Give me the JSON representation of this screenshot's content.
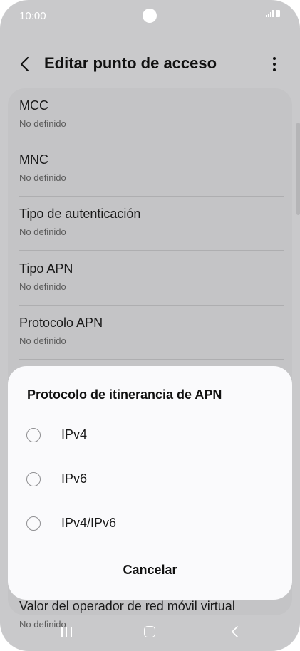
{
  "status_bar": {
    "time": "10:00"
  },
  "header": {
    "title": "Editar punto de acceso"
  },
  "settings": [
    {
      "title": "MCC",
      "value": "No definido"
    },
    {
      "title": "MNC",
      "value": "No definido"
    },
    {
      "title": "Tipo de autenticación",
      "value": "No definido"
    },
    {
      "title": "Tipo APN",
      "value": "No definido"
    },
    {
      "title": "Protocolo APN",
      "value": "No definido"
    },
    {
      "title": "Valor del operador de red móvil virtual",
      "value": "No definido"
    }
  ],
  "dialog": {
    "title": "Protocolo de itinerancia de APN",
    "options": [
      {
        "label": "IPv4",
        "selected": false
      },
      {
        "label": "IPv6",
        "selected": false
      },
      {
        "label": "IPv4/IPv6",
        "selected": false
      }
    ],
    "cancel_label": "Cancelar"
  },
  "icons": {
    "back": "back-arrow-icon",
    "more": "more-vert-icon",
    "nav_recents": "recents-icon",
    "nav_home": "home-icon",
    "nav_back": "nav-back-icon"
  }
}
